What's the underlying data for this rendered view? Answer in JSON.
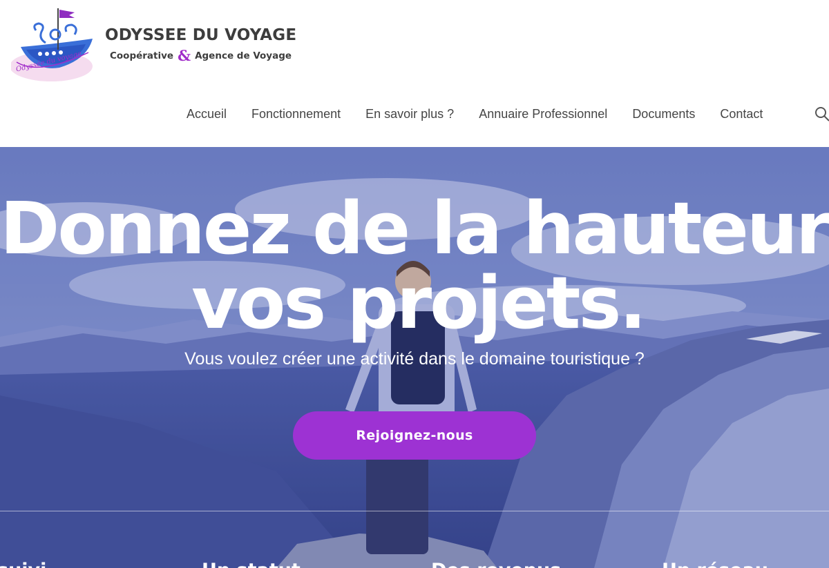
{
  "brand": {
    "title": "ODYSSEE DU VOYAGE",
    "subtitle_left": "Coopérative",
    "subtitle_amp": "&",
    "subtitle_right": "Agence de Voyage",
    "logo_script": "Odyssée du voyage"
  },
  "nav": {
    "items": [
      "Accueil",
      "Fonctionnement",
      "En savoir plus ?",
      "Annuaire Professionnel",
      "Documents",
      "Contact"
    ],
    "search_icon": "search-icon"
  },
  "hero": {
    "title_line1": "Donnez de la hauteur à",
    "title_line2": "vos projets.",
    "subtitle": "Vous voulez créer une activité dans le domaine touristique ?",
    "cta_label": "Rejoignez-nous"
  },
  "features": [
    "suivi",
    "Un statut",
    "Des revenus",
    "Un réseau"
  ],
  "colors": {
    "accent": "#9d32d3",
    "brand_text": "#3d3d3d",
    "nav_text": "#454545",
    "hero_overlay": "#5b6db3"
  }
}
